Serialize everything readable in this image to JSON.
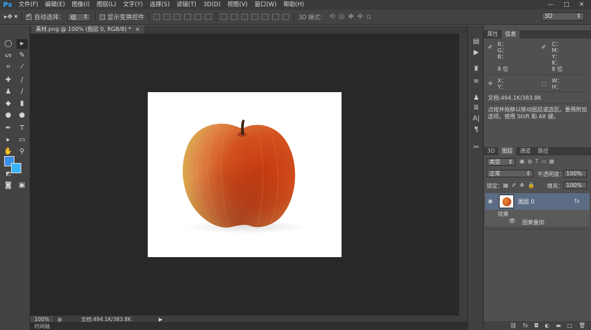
{
  "app": {
    "logo": "Ps"
  },
  "menu": [
    "文件(F)",
    "编辑(E)",
    "图像(I)",
    "图层(L)",
    "文字(Y)",
    "选择(S)",
    "滤镜(T)",
    "3D(D)",
    "视图(V)",
    "窗口(W)",
    "帮助(H)"
  ],
  "window_controls": {
    "minimize": "—",
    "maximize": "□",
    "close": "✕"
  },
  "options": {
    "auto_select_label": "自动选择：",
    "auto_select_value": "组",
    "show_transform_label": "显示变换控件",
    "mode3d_label": "3D 模式：",
    "workspace_value": "3D"
  },
  "document": {
    "tab_title": "素材.png @ 100% (图层 0, RGB/8) *",
    "close": "×"
  },
  "status": {
    "zoom": "100%",
    "doc_info": "文档:494.1K/383.8K"
  },
  "timeline": {
    "label": "时间轴"
  },
  "info_panel": {
    "tabs": [
      "属性",
      "信息"
    ],
    "rgb": [
      "R：",
      "G：",
      "B："
    ],
    "cmyk": [
      "C：",
      "M：",
      "Y：",
      "K："
    ],
    "bit_left": "8 位",
    "bit_right": "8 位",
    "xy": [
      "X：",
      "Y："
    ],
    "wh": [
      "W：",
      "H："
    ],
    "doc_info": "文档:494.1K/383.8K",
    "hint": "点按并拖移以移动图层或选区。要用附加选项，使用 Shift 和 Alt 键。"
  },
  "layers_panel": {
    "tabs": [
      "3D",
      "图层",
      "通道",
      "路径"
    ],
    "filter_kind": "类型",
    "blend_mode": "正常",
    "opacity_label": "不透明度：",
    "opacity_value": "100%",
    "lock_label": "锁定：",
    "fill_label": "填充：",
    "fill_value": "100%",
    "layer_name": "图层 0",
    "fx_badge": "fx",
    "effects_label": "效果",
    "effect_name": "图案叠加"
  }
}
